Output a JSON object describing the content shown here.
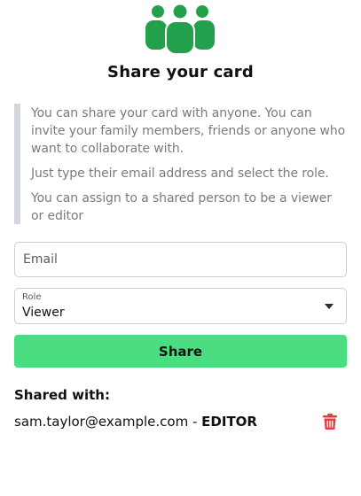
{
  "colors": {
    "accent_green": "#22a04b",
    "button_green": "#4ade80",
    "delete_red": "#e53e3e",
    "info_text": "#7b7b7b",
    "quote_bar": "#d3d6dc"
  },
  "header": {
    "icon": "users-group-icon",
    "title": "Share your card"
  },
  "info": {
    "paragraphs": [
      "You can share your card with anyone. You can invite your family members, friends or anyone who want to collaborate with.",
      "Just type their email address and select the role.",
      "You can assign to a shared person to be a viewer or editor"
    ]
  },
  "form": {
    "email_placeholder": "Email",
    "email_value": "",
    "role_label": "Role",
    "role_value": "Viewer",
    "share_label": "Share"
  },
  "shared": {
    "heading": "Shared with:",
    "items": [
      {
        "email": "sam.taylor@example.com",
        "separator": " - ",
        "role": "EDITOR",
        "delete_icon": "trash-icon"
      }
    ]
  }
}
